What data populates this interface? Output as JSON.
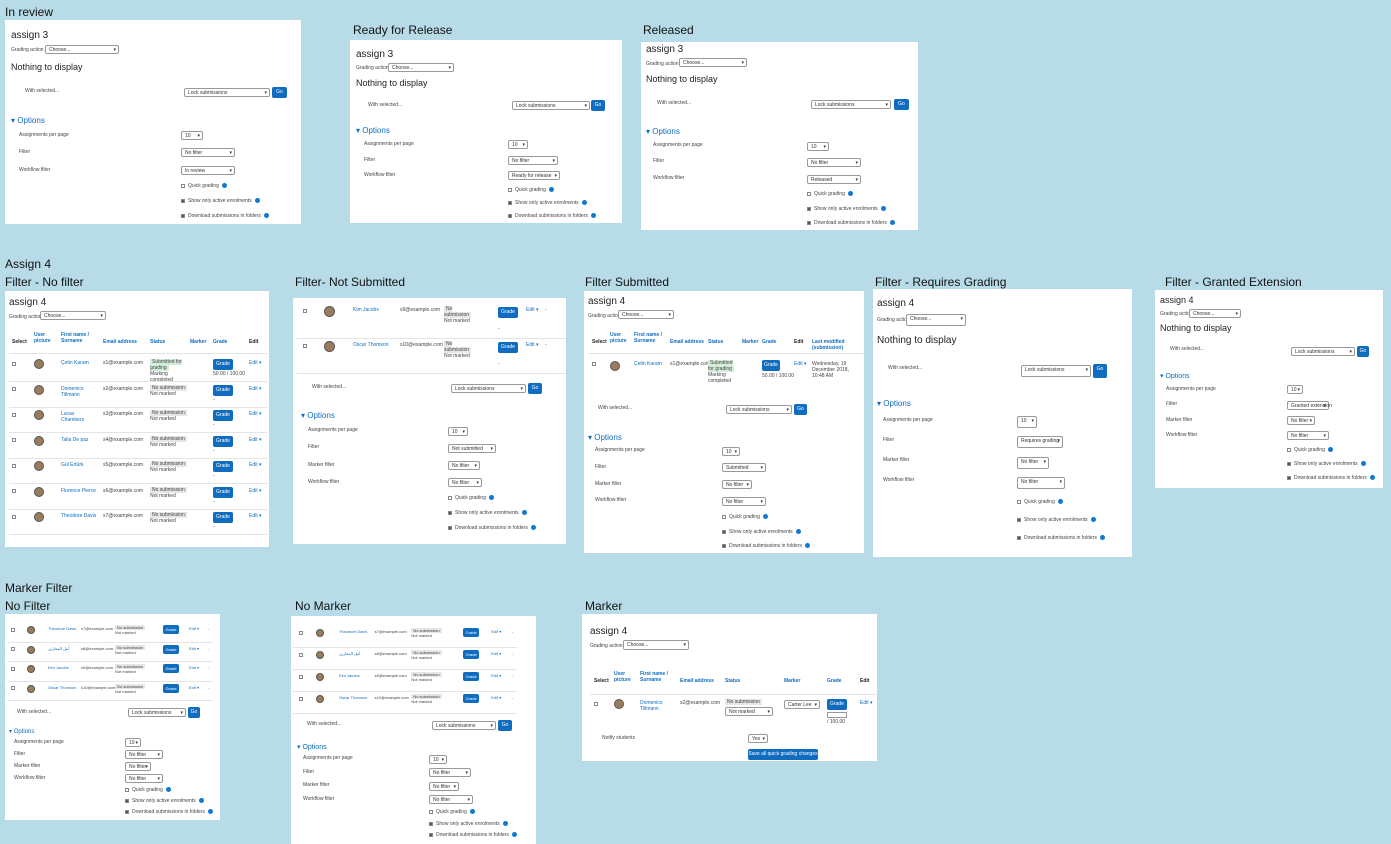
{
  "labels": {
    "in_review": "In review",
    "ready": "Ready for Release",
    "released": "Released",
    "assign4": "Assign 4",
    "no_filter": "Filter -  No filter",
    "not_submitted": "Filter- Not Submitted",
    "submitted": "Filter Submitted",
    "requires_grading": "Filter - Requires Grading",
    "granted_ext": "Filter - Granted Extension",
    "marker_filter": "Marker Filter",
    "mf_no_filter": "No Filter",
    "no_marker": "No Marker",
    "marker": "Marker"
  },
  "common": {
    "assign3": "assign 3",
    "assign4": "assign 4",
    "grading_action": "Grading action",
    "choose": "Choose...",
    "nothing": "Nothing to display",
    "with_selected": "With selected...",
    "lock": "Lock submissions",
    "go": "Go",
    "options": "Options",
    "app": "Assignments per page",
    "filter": "Filter",
    "marker_filter": "Marker filter",
    "workflow_filter": "Workflow filter",
    "ten": "10",
    "no_filter": "No filter",
    "quick": "Quick grading",
    "active": "Show only active enrolments",
    "download": "Download submissions in folders",
    "grade": "Grade",
    "edit": "Edit",
    "dash": "-",
    "h_select": "Select",
    "h_user": "User picture",
    "h_name": "First name / Surname",
    "h_email": "Email address",
    "h_status": "Status",
    "h_marker": "Marker",
    "h_grade": "Grade",
    "h_edit": "Edit",
    "h_last": "Last modified (submission)",
    "no_sub": "No submission",
    "not_marked": "Not marked",
    "submitted_grading": "Submitted for grading",
    "marking_completed": "Marking completed",
    "notify": "Notify students",
    "yes": "Yes",
    "save_all": "Save all quick grading changes"
  },
  "workflow": {
    "in_review": "In review",
    "ready": "Ready for release",
    "released": "Released"
  },
  "filters": {
    "not_submitted": "Not submitted",
    "submitted": "Submitted",
    "requires": "Requires grading",
    "granted": "Granted extension"
  },
  "rows_p4": [
    {
      "name": "Çetin Karam",
      "email": "s1@example.com"
    },
    {
      "name": "Domenico Tillmann",
      "email": "s2@example.com"
    },
    {
      "name": "Lucas Chambers",
      "email": "s3@example.com"
    },
    {
      "name": "Talia De paz",
      "email": "s4@example.com"
    },
    {
      "name": "Gül Ertürk",
      "email": "s5@example.com"
    },
    {
      "name": "Florence Pierce",
      "email": "s6@example.com"
    },
    {
      "name": "Theodore Davis",
      "email": "s7@example.com"
    }
  ],
  "grade_val": "50.00 / 100.00",
  "rows_ns": [
    {
      "name": "Kim Jacobs",
      "email": "s9@example.com"
    },
    {
      "name": "Oscar Thomson",
      "email": "s10@example.com"
    }
  ],
  "last_modified": "Wednesday, 19 December 2018, 10:48 AM",
  "rows_mf": [
    {
      "name": "Theodore Davis",
      "email": "s7@example.com"
    },
    {
      "name": "أنيل المعازين",
      "email": "s8@example.com"
    },
    {
      "name": "Kim Jacobs",
      "email": "s9@example.com"
    },
    {
      "name": "Oscar Thomson",
      "email": "s10@example.com"
    }
  ],
  "marker_row": {
    "name": "Domenico Tillmann",
    "email": "s2@example.com",
    "marker": "Carter Lee",
    "grade_of": "/ 100.00"
  }
}
